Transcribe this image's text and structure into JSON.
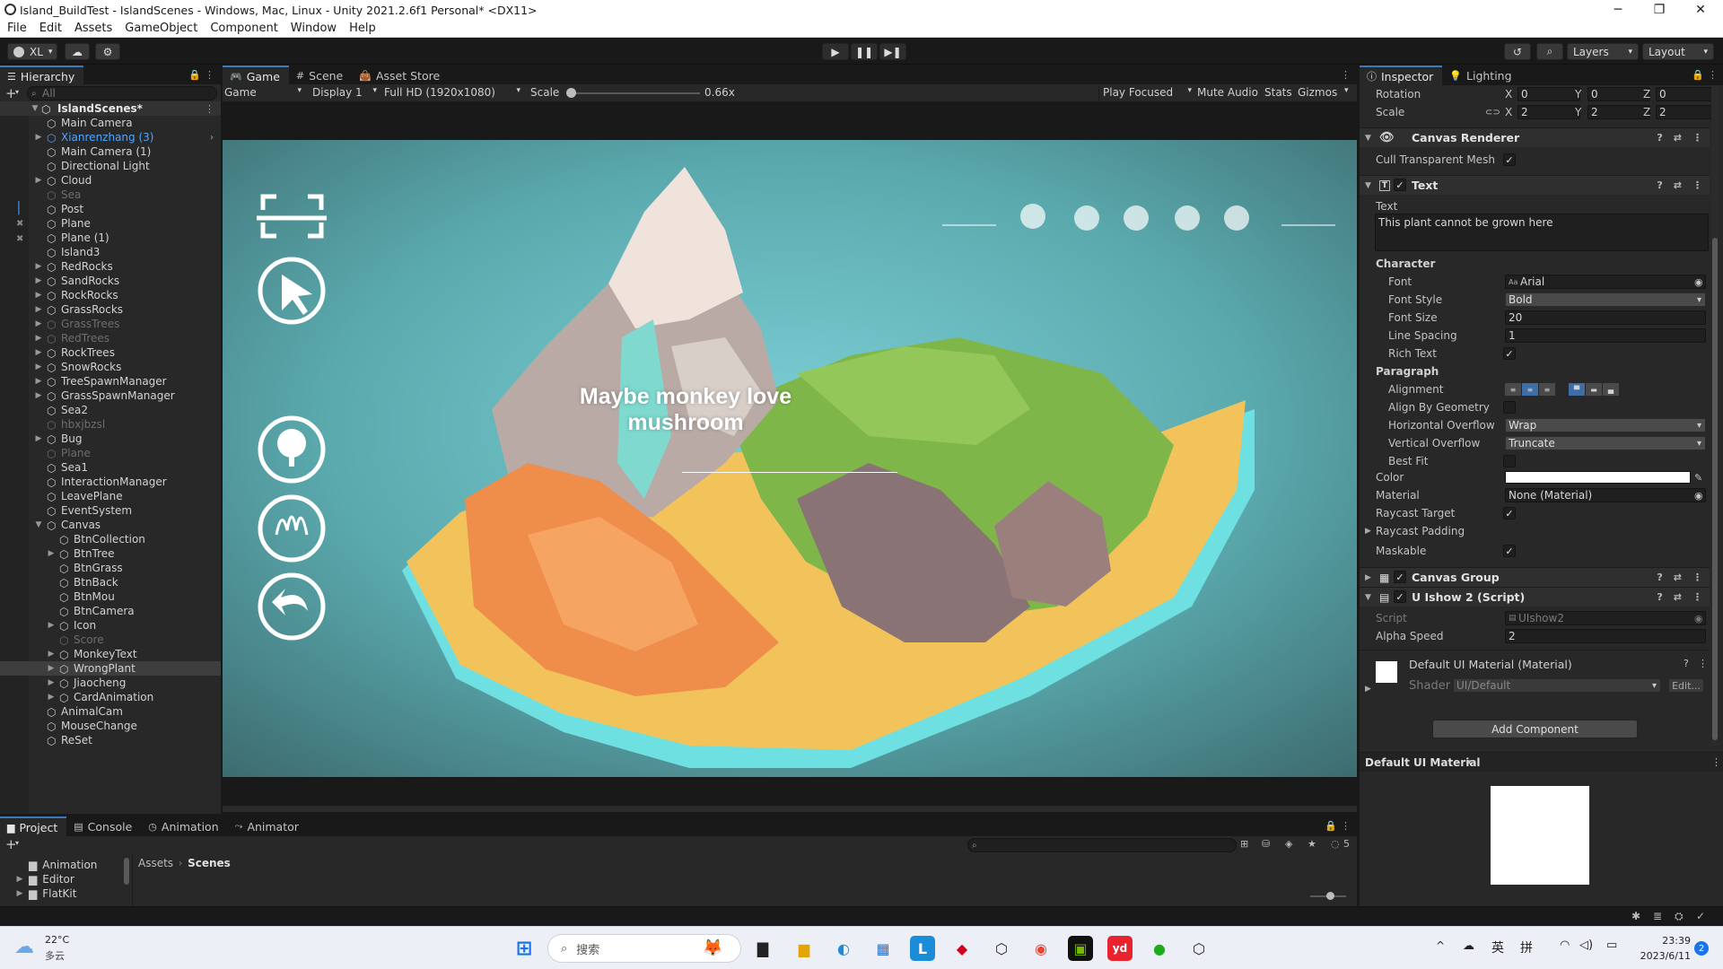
{
  "window": {
    "title": "Island_BuildTest - IslandScenes - Windows, Mac, Linux - Unity 2021.2.6f1 Personal* <DX11>"
  },
  "menu": [
    "File",
    "Edit",
    "Assets",
    "GameObject",
    "Component",
    "Window",
    "Help"
  ],
  "toolbar": {
    "account": "XL",
    "layers": "Layers",
    "layout": "Layout"
  },
  "hierarchy": {
    "tab": "Hierarchy",
    "search_placeholder": "All",
    "scene": "IslandScenes*",
    "items": [
      {
        "label": "Main Camera"
      },
      {
        "label": "Xianrenzhang (3)"
      },
      {
        "label": "Main Camera (1)"
      },
      {
        "label": "Directional Light"
      },
      {
        "label": "Cloud"
      },
      {
        "label": "Sea"
      },
      {
        "label": "Post"
      },
      {
        "label": "Plane"
      },
      {
        "label": "Plane (1)"
      },
      {
        "label": "Island3"
      },
      {
        "label": "RedRocks"
      },
      {
        "label": "SandRocks"
      },
      {
        "label": "RockRocks"
      },
      {
        "label": "GrassRocks"
      },
      {
        "label": "GrassTrees"
      },
      {
        "label": "RedTrees"
      },
      {
        "label": "RockTrees"
      },
      {
        "label": "SnowRocks"
      },
      {
        "label": "TreeSpawnManager"
      },
      {
        "label": "GrassSpawnManager"
      },
      {
        "label": "Sea2"
      },
      {
        "label": "hbxjbzsl"
      },
      {
        "label": "Bug"
      },
      {
        "label": "Plane"
      },
      {
        "label": "Sea1"
      },
      {
        "label": "InteractionManager"
      },
      {
        "label": "LeavePlane"
      },
      {
        "label": "EventSystem"
      },
      {
        "label": "Canvas"
      },
      {
        "label": "BtnCollection"
      },
      {
        "label": "BtnTree"
      },
      {
        "label": "BtnGrass"
      },
      {
        "label": "BtnBack"
      },
      {
        "label": "BtnMou"
      },
      {
        "label": "BtnCamera"
      },
      {
        "label": "Icon"
      },
      {
        "label": "Score"
      },
      {
        "label": "MonkeyText"
      },
      {
        "label": "WrongPlant"
      },
      {
        "label": "Jiaocheng"
      },
      {
        "label": "CardAnimation"
      },
      {
        "label": "AnimalCam"
      },
      {
        "label": "MouseChange"
      },
      {
        "label": "ReSet"
      }
    ]
  },
  "game": {
    "tabs": [
      "Game",
      "Scene",
      "Asset Store"
    ],
    "display_mode": "Game",
    "display": "Display 1",
    "resolution": "Full HD (1920x1080)",
    "scale_label": "Scale",
    "scale_value": "0.66x",
    "scale_fraction": 0.03,
    "play_focused": "Play Focused",
    "mute": "Mute Audio",
    "stats": "Stats",
    "gizmos": "Gizmos",
    "overlay_text": "Maybe monkey love mushroom"
  },
  "inspector": {
    "tabs": [
      "Inspector",
      "Lighting"
    ],
    "rotation_label": "Rotation",
    "rotation": {
      "x": "0",
      "y": "0",
      "z": "0"
    },
    "scale_label": "Scale",
    "scale": {
      "x": "2",
      "y": "2",
      "z": "2"
    },
    "axis": {
      "x": "X",
      "y": "Y",
      "z": "Z"
    },
    "canvas_renderer": "Canvas Renderer",
    "cull_label": "Cull Transparent Mesh",
    "text_comp": "Text",
    "text_label": "Text",
    "text_value": "This plant cannot be grown here",
    "character": "Character",
    "font_label": "Font",
    "font_value": "Arial",
    "font_style_label": "Font Style",
    "font_style": "Bold",
    "font_size_label": "Font Size",
    "font_size": "20",
    "line_spacing_label": "Line Spacing",
    "line_spacing": "1",
    "rich_text_label": "Rich Text",
    "paragraph": "Paragraph",
    "alignment_label": "Alignment",
    "align_geom_label": "Align By Geometry",
    "h_overflow_label": "Horizontal Overflow",
    "h_overflow": "Wrap",
    "v_overflow_label": "Vertical Overflow",
    "v_overflow": "Truncate",
    "best_fit_label": "Best Fit",
    "color_label": "Color",
    "material_label": "Material",
    "material_value": "None (Material)",
    "raycast_target_label": "Raycast Target",
    "raycast_padding_label": "Raycast Padding",
    "maskable_label": "Maskable",
    "canvas_group": "Canvas Group",
    "script_comp": "U Ishow 2 (Script)",
    "script_label": "Script",
    "script_value": "UIshow2",
    "alpha_label": "Alpha Speed",
    "alpha_value": "2",
    "mat_title": "Default UI Material (Material)",
    "shader_label": "Shader",
    "shader_value": "UI/Default",
    "edit": "Edit...",
    "add_component": "Add Component",
    "preview_title": "Default UI Material"
  },
  "project": {
    "tabs": [
      "Project",
      "Console",
      "Animation",
      "Animator"
    ],
    "folders": [
      "Animation",
      "Editor",
      "FlatKit"
    ],
    "breadcrumb": [
      "Assets",
      "Scenes"
    ],
    "hidden_count": "5"
  },
  "taskbar": {
    "temp": "22°C",
    "weather": "多云",
    "search": "搜索",
    "ime1": "英",
    "ime2": "拼",
    "time": "23:39",
    "date": "2023/6/11",
    "notif": "2"
  }
}
